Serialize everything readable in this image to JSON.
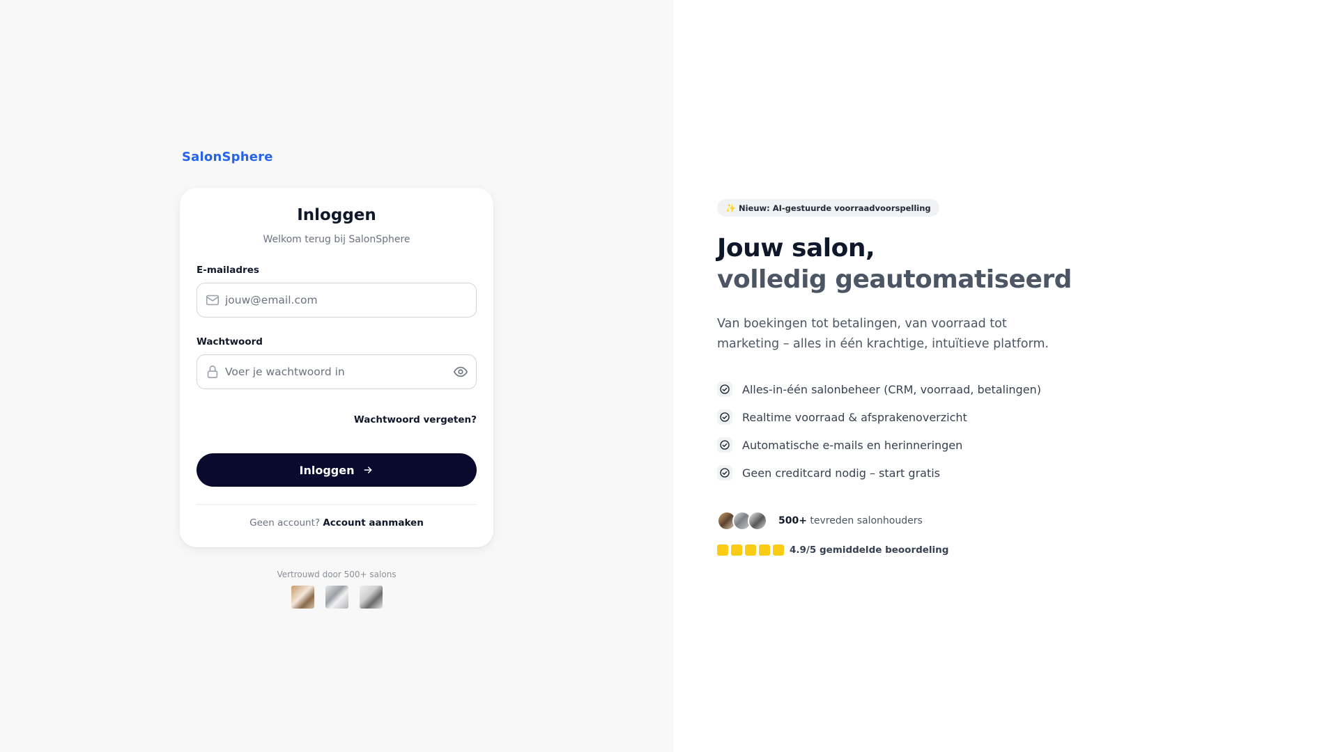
{
  "brand": {
    "logo_text": "SalonSphere",
    "color": "#2563eb"
  },
  "login_card": {
    "title": "Inloggen",
    "subtitle": "Welkom terug bij SalonSphere",
    "email": {
      "label": "E-mailadres",
      "placeholder": "jouw@email.com",
      "value": "",
      "icon": "mail-icon"
    },
    "password": {
      "label": "Wachtwoord",
      "placeholder": "Voer je wachtwoord in",
      "value": "",
      "icon": "lock-icon",
      "toggle_icon": "eye-icon"
    },
    "forgot_password": "Wachtwoord vergeten?",
    "submit_label": "Inloggen",
    "submit_icon": "arrow-right-icon",
    "signup_prompt": "Geen account?",
    "signup_link": "Account aanmaken"
  },
  "trusted": {
    "text": "Vertrouwd door 500+ salons",
    "thumbnails": [
      "salon-photo-1",
      "salon-photo-2",
      "salon-photo-3"
    ]
  },
  "hero": {
    "badge": "Nieuw: AI-gestuurde voorraadvoorspelling",
    "badge_icon": "sparkle-icon",
    "headline_line1": "Jouw salon,",
    "headline_line2": "volledig geautomatiseerd",
    "lead": "Van boekingen tot betalingen, van voorraad tot marketing – alles in één krachtige, intuïtieve platform.",
    "features": [
      "Alles-in-één salonbeheer (CRM, voorraad, betalingen)",
      "Realtime voorraad & afsprakenoverzicht",
      "Automatische e-mails en herinneringen",
      "Geen creditcard nodig – start gratis"
    ],
    "social_count": "500+",
    "social_text": "tevreden salonhouders",
    "rating_stars": 5,
    "rating_text": "4.9/5 gemiddelde beoordeling"
  },
  "colors": {
    "button_bg": "#0a0a2e",
    "star": "#facc15",
    "left_bg": "#f8f8f8"
  }
}
